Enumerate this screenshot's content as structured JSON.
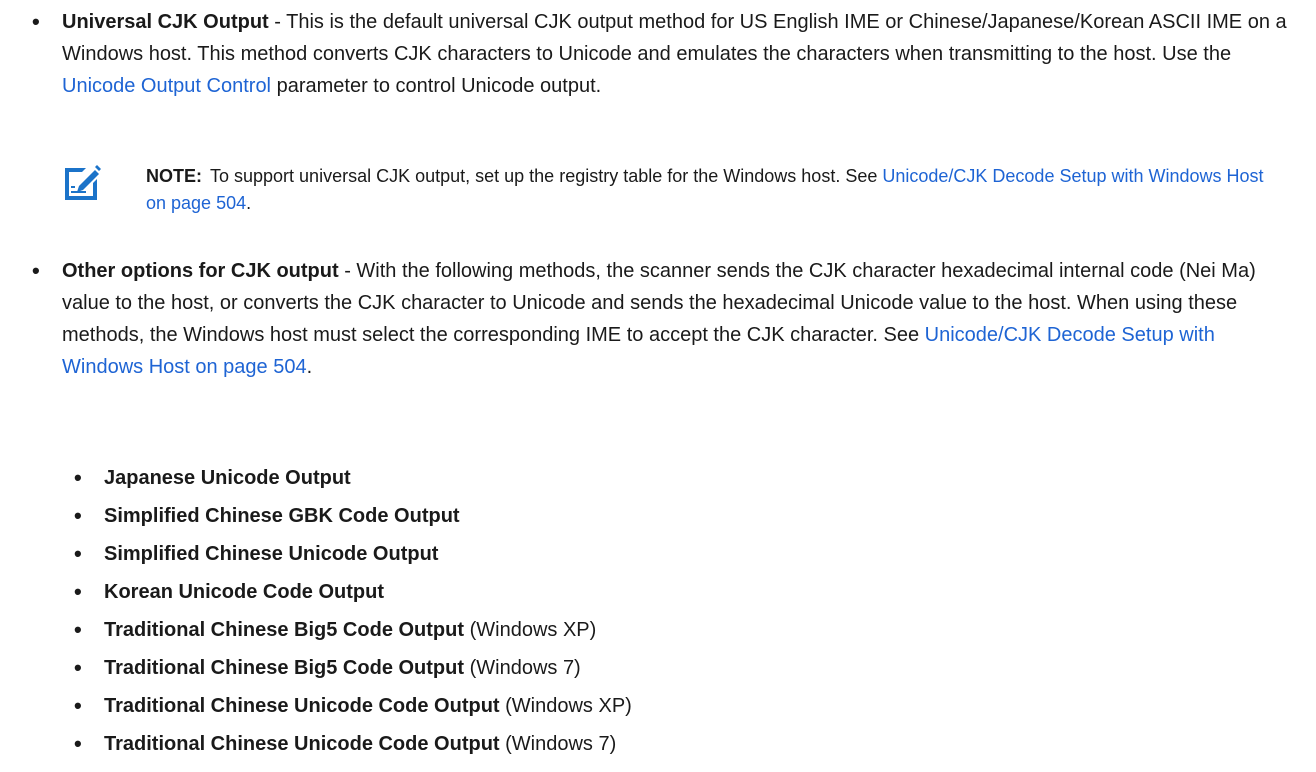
{
  "bullet_char": "•",
  "universal": {
    "title": "Universal CJK Output",
    "text_1": " - This is the default universal CJK output method for US English IME or Chinese/Japanese/Korean ASCII IME on a Windows host. This method converts CJK characters to Unicode and emulates the characters when transmitting to the host. Use the ",
    "link": "Unicode Output Control",
    "text_2": " parameter to control Unicode output."
  },
  "note": {
    "label": "NOTE:",
    "text_1": "To support universal CJK output, set up the registry table for the Windows host. See ",
    "link": "Unicode/CJK Decode Setup with Windows Host on page 504",
    "text_2": "."
  },
  "other": {
    "title": "Other options for CJK output",
    "text_1": " - With the following methods, the scanner sends the CJK character hexadecimal internal code (Nei Ma) value to the host, or converts the CJK character to Unicode and sends the hexadecimal Unicode value to the host. When using these methods, the Windows host must select the corresponding IME to accept the CJK character. See ",
    "link": "Unicode/CJK Decode Setup with Windows Host on page 504",
    "text_2": "."
  },
  "sub_items": [
    {
      "title": "Japanese Unicode Output",
      "suffix": ""
    },
    {
      "title": "Simplified Chinese GBK Code Output",
      "suffix": ""
    },
    {
      "title": "Simplified Chinese Unicode Output",
      "suffix": ""
    },
    {
      "title": "Korean Unicode Code Output",
      "suffix": ""
    },
    {
      "title": "Traditional Chinese Big5 Code Output",
      "suffix": " (Windows XP)"
    },
    {
      "title": "Traditional Chinese Big5 Code Output",
      "suffix": " (Windows 7)"
    },
    {
      "title": "Traditional Chinese Unicode Code Output",
      "suffix": " (Windows XP)"
    },
    {
      "title": "Traditional Chinese Unicode Code Output",
      "suffix": " (Windows 7)"
    }
  ],
  "colors": {
    "link": "#1e64d4",
    "note_icon": "#1b73c9",
    "text": "#1a1a1a"
  },
  "icons": {
    "note": "note-pencil-icon"
  }
}
